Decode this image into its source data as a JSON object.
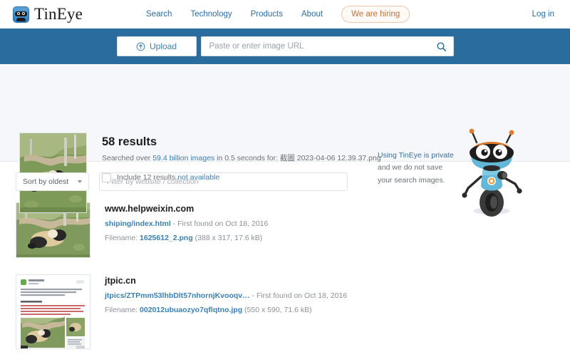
{
  "nav": {
    "brand": "TinEye",
    "links": [
      {
        "label": "Search"
      },
      {
        "label": "Technology"
      },
      {
        "label": "Products"
      },
      {
        "label": "About"
      }
    ],
    "hiring_label": "We are hiring",
    "login_label": "Log in"
  },
  "search": {
    "upload_label": "Upload",
    "url_placeholder": "Paste or enter image URL",
    "url_value": ""
  },
  "summary": {
    "results_count": "58 results",
    "searched_prefix": "Searched over ",
    "searched_images": "59.4 billion images",
    "searched_middle": " in 0.5 seconds for: ",
    "query_filename": "截圖 2023-04-06 12.39.37.png",
    "include_prefix": "Include 12 results ",
    "include_link": "not available",
    "privacy_heading": "Using TinEye is private",
    "privacy_body": "and we do not save your search images."
  },
  "filters": {
    "sort_label": "Sort by oldest",
    "filter_placeholder": "Filter by website / collection",
    "filter_value": ""
  },
  "results": [
    {
      "domain": "www.helpweixin.com",
      "path": "shiping/index.html",
      "found": " - First found on Oct 18, 2016",
      "filename_label": "Filename: ",
      "filename": "1625612_2.png",
      "meta": " (388 x 317, 17.6 kB)"
    },
    {
      "domain": "jtpic.cn",
      "path": "jtpics/ZTPmm53lhbDlt57nhornjKvooqv…",
      "found": " - First found on Oct 18, 2016",
      "filename_label": "Filename: ",
      "filename": "002012ubuaozyo7qflqtno.jpg",
      "meta": " (550 x 590, 71.6 kB)"
    }
  ],
  "colors": {
    "brand_blue": "#2b6c9e",
    "link_blue": "#3a7fb5",
    "hiring_orange": "#c2703a",
    "panel_bg": "#f5f7fa"
  }
}
